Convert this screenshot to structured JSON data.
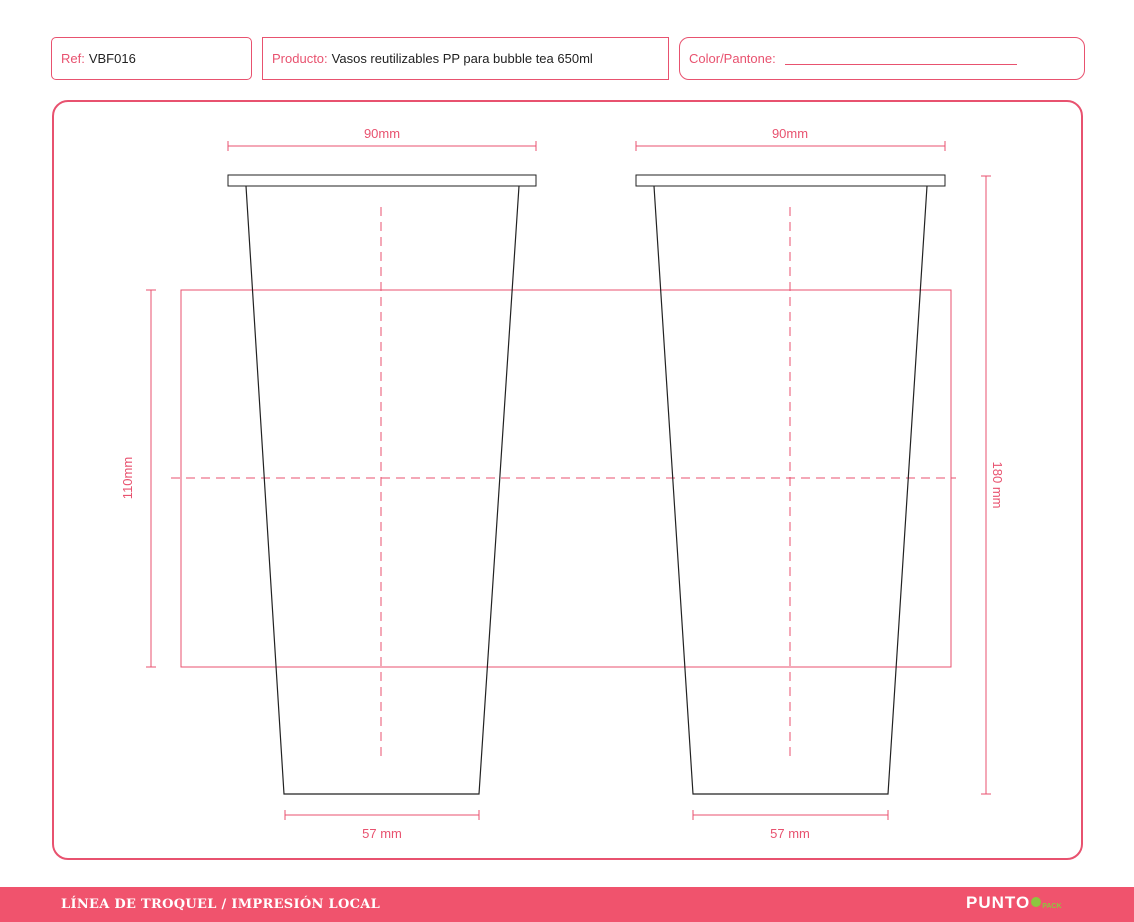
{
  "header": {
    "ref_label": "Ref:",
    "ref_value": "VBF016",
    "product_label": "Producto:",
    "product_value": "Vasos reutilizables PP para bubble tea 650ml",
    "color_label": "Color/Pantone:"
  },
  "dimensions": {
    "top_width": "90mm",
    "bottom_width": "57 mm",
    "print_height": "110mm",
    "total_height": "180 mm"
  },
  "footer": {
    "text": "LÍNEA DE TROQUEL / IMPRESIÓN LOCAL",
    "logo_main": "PUNTO",
    "logo_sub": "PACK"
  },
  "colors": {
    "accent": "#e8526f",
    "footer_bg": "#f0536d",
    "logo_green": "#8dc63f",
    "outline": "#222222"
  }
}
